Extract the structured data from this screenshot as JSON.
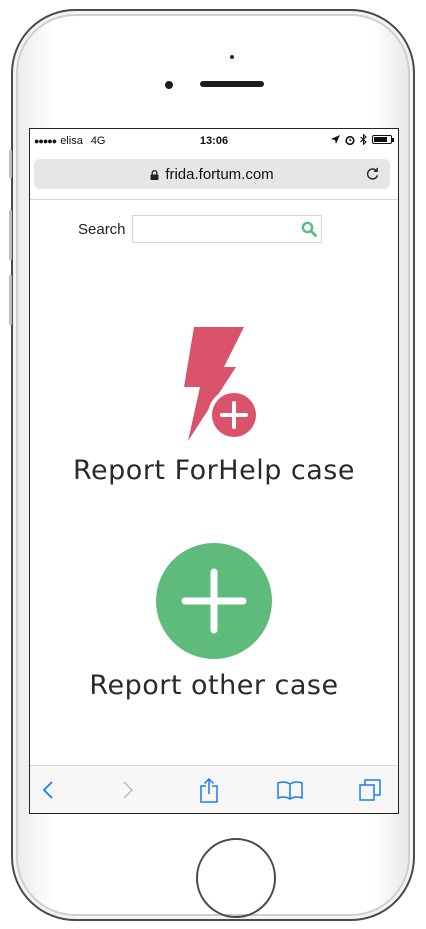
{
  "status_bar": {
    "carrier": "elisa",
    "network": "4G",
    "time": "13:06",
    "battery_level": 0.7
  },
  "browser": {
    "url": "frida.fortum.com"
  },
  "search": {
    "label": "Search",
    "value": "",
    "placeholder": ""
  },
  "actions": [
    {
      "label": "Report ForHelp case",
      "icon": "lightning-plus-icon",
      "color": "#d9536a"
    },
    {
      "label": "Report other case",
      "icon": "plus-circle-icon",
      "color": "#5fbb7b"
    }
  ],
  "toolbar": {
    "buttons": [
      "back-icon",
      "forward-icon",
      "share-icon",
      "bookmarks-icon",
      "tabs-icon"
    ],
    "accent": "#1a7cf5",
    "disabled": "#c5c5c5"
  },
  "theme": {
    "search_icon_color": "#5fbb7b"
  }
}
